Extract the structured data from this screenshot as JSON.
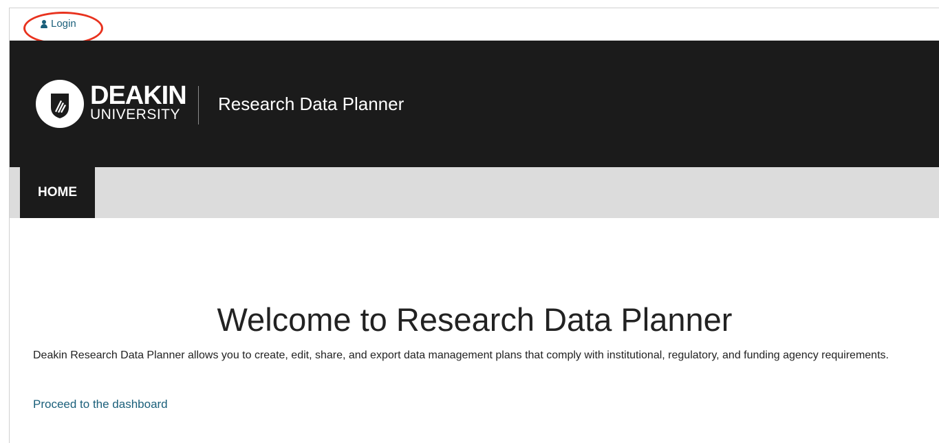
{
  "topbar": {
    "login_label": "Login",
    "login_icon": "user-icon"
  },
  "header": {
    "logo_line1": "DEAKIN",
    "logo_line2": "UNIVERSITY",
    "site_title": "Research Data Planner"
  },
  "nav": {
    "items": [
      {
        "label": "HOME",
        "active": true
      }
    ]
  },
  "main": {
    "title": "Welcome to Research Data Planner",
    "intro": "Deakin Research Data Planner allows you to create, edit, share, and export data management plans that comply with institutional, regulatory, and funding agency requirements.",
    "dashboard_link": "Proceed to the dashboard"
  },
  "colors": {
    "header_bg": "#1b1b1b",
    "nav_bg": "#dcdcdc",
    "link": "#1a5f7a",
    "highlight": "#e8321e"
  }
}
